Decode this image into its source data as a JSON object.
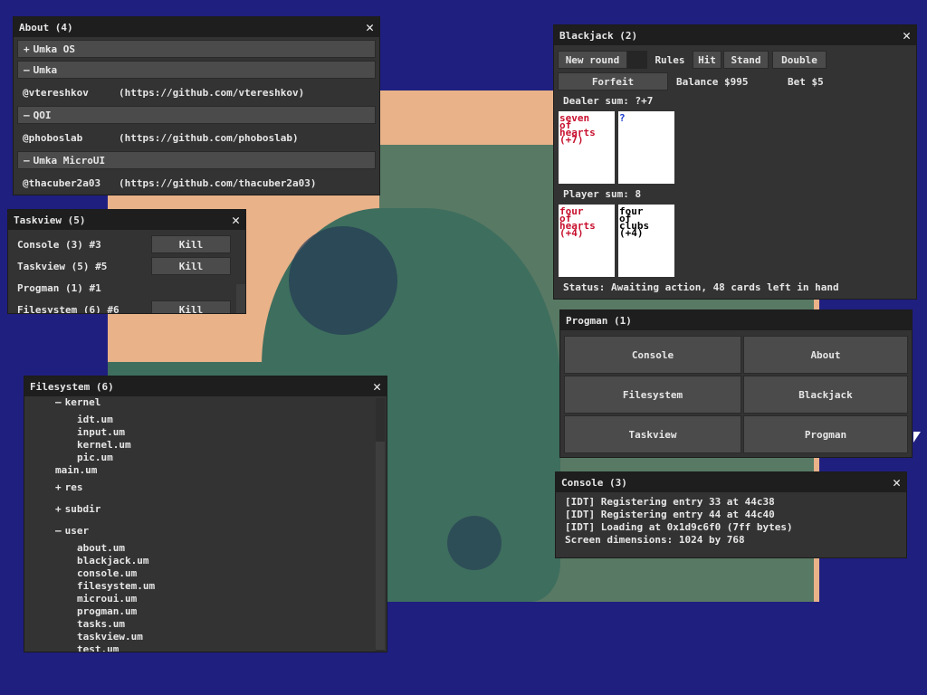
{
  "about": {
    "title": "About (4)",
    "sections": [
      {
        "label": "Umka OS",
        "expanded": false
      },
      {
        "label": "Umka",
        "expanded": true,
        "credit": "@vtereshkov     (https://github.com/vtereshkov)"
      },
      {
        "label": "QOI",
        "expanded": true,
        "credit": "@phoboslab      (https://github.com/phoboslab)"
      },
      {
        "label": "Umka MicroUI",
        "expanded": true,
        "credit": "@thacuber2a03   (https://github.com/thacuber2a03)"
      }
    ]
  },
  "taskview": {
    "title": "Taskview (5)",
    "rows": [
      {
        "name": "Console (3) #3",
        "kill": "Kill"
      },
      {
        "name": "Taskview (5) #5",
        "kill": "Kill"
      },
      {
        "name": "Progman (1) #1",
        "kill": ""
      },
      {
        "name": "Filesystem (6) #6",
        "kill": "Kill"
      }
    ]
  },
  "blackjack": {
    "title": "Blackjack (2)",
    "buttons": {
      "new_round": "New round",
      "rules": "Rules",
      "hit": "Hit",
      "stand": "Stand",
      "double": "Double",
      "forfeit": "Forfeit"
    },
    "balance": "Balance $995",
    "bet": "Bet $5",
    "dealer_sum": "Dealer sum: ?+7",
    "player_sum": "Player sum: 8",
    "dealer_cards": [
      {
        "lines": [
          "seven",
          "of",
          "hearts",
          "(+7)"
        ],
        "color": "#c8102e"
      },
      {
        "lines": [
          "?",
          "",
          "",
          ""
        ],
        "color": "#1a3acc"
      }
    ],
    "player_cards": [
      {
        "lines": [
          "four",
          "of",
          "hearts",
          "(+4)"
        ],
        "color": "#c8102e"
      },
      {
        "lines": [
          "four",
          "of",
          "clubs",
          "(+4)"
        ],
        "color": "#000000"
      }
    ],
    "status": "Status: Awaiting action, 48 cards left in hand"
  },
  "progman": {
    "title": "Progman (1)",
    "apps": [
      "Console",
      "About",
      "Filesystem",
      "Blackjack",
      "Taskview",
      "Progman"
    ]
  },
  "filesystem": {
    "title": "Filesystem (6)",
    "items": [
      {
        "text": "kernel",
        "prefix": "—",
        "level": 1
      },
      {
        "text": "idt.um",
        "prefix": "",
        "level": 2
      },
      {
        "text": "input.um",
        "prefix": "",
        "level": 2
      },
      {
        "text": "kernel.um",
        "prefix": "",
        "level": 2
      },
      {
        "text": "pic.um",
        "prefix": "",
        "level": 2
      },
      {
        "text": "main.um",
        "prefix": "",
        "level": 1
      },
      {
        "text": "res",
        "prefix": "+",
        "level": 1
      },
      {
        "text": "subdir",
        "prefix": "+",
        "level": 1
      },
      {
        "text": "user",
        "prefix": "—",
        "level": 1
      },
      {
        "text": "about.um",
        "prefix": "",
        "level": 2
      },
      {
        "text": "blackjack.um",
        "prefix": "",
        "level": 2
      },
      {
        "text": "console.um",
        "prefix": "",
        "level": 2
      },
      {
        "text": "filesystem.um",
        "prefix": "",
        "level": 2
      },
      {
        "text": "microui.um",
        "prefix": "",
        "level": 2
      },
      {
        "text": "progman.um",
        "prefix": "",
        "level": 2
      },
      {
        "text": "tasks.um",
        "prefix": "",
        "level": 2
      },
      {
        "text": "taskview.um",
        "prefix": "",
        "level": 2
      },
      {
        "text": "test.um",
        "prefix": "",
        "level": 2
      }
    ]
  },
  "console": {
    "title": "Console (3)",
    "lines": [
      "[IDT] Registering entry 33 at 44c38",
      "[IDT] Registering entry 44 at 44c40",
      "[IDT] Loading at 0x1d9c6f0 (7ff bytes)",
      "Screen dimensions: 1024 by 768"
    ]
  },
  "colors": {
    "desktop": "#1f1f7f",
    "window": "#333333",
    "titlebar": "#1e1e1e",
    "button": "#4b4b4b"
  }
}
